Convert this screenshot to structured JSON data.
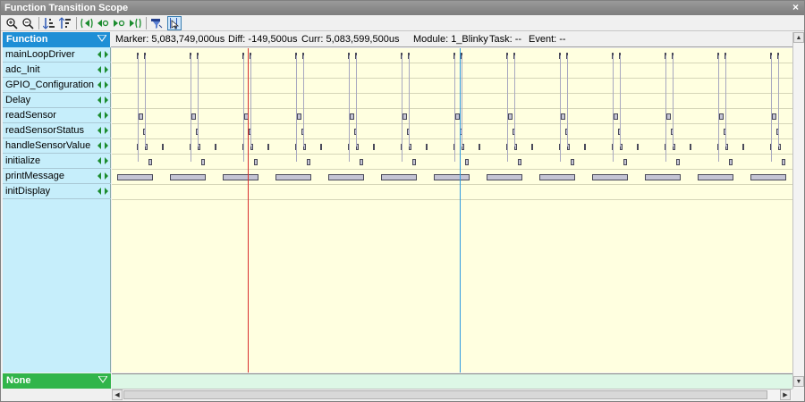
{
  "window": {
    "title": "Function Transition Scope",
    "close_glyph": "×"
  },
  "toolbar": {
    "buttons": [
      {
        "name": "zoom-in-icon"
      },
      {
        "name": "zoom-out-icon"
      },
      {
        "name": "sort-ascending-icon"
      },
      {
        "name": "sort-descending-icon"
      },
      {
        "name": "jump-first-icon"
      },
      {
        "name": "jump-previous-icon"
      },
      {
        "name": "jump-next-icon"
      },
      {
        "name": "jump-last-icon"
      },
      {
        "name": "filter-icon"
      },
      {
        "name": "cursor-mode-icon"
      }
    ]
  },
  "function_header": {
    "label": "Function"
  },
  "functions": [
    {
      "name": "mainLoopDriver"
    },
    {
      "name": "adc_Init"
    },
    {
      "name": "GPIO_Configuration"
    },
    {
      "name": "Delay"
    },
    {
      "name": "readSensor"
    },
    {
      "name": "readSensorStatus"
    },
    {
      "name": "handleSensorValue"
    },
    {
      "name": "initialize"
    },
    {
      "name": "printMessage"
    },
    {
      "name": "initDisplay"
    }
  ],
  "none_bar": {
    "label": "None"
  },
  "info": {
    "marker": "Marker: 5,083,749,000us",
    "diff": "Diff: -149,500us",
    "curr": "Curr: 5,083,599,500us",
    "module": "Module: 1_Blinky",
    "task": "Task: --",
    "event": "Event: --"
  },
  "colors": {
    "plot_bg": "#ffffe0",
    "marker_line": "#d93030",
    "cursor_line": "#2f9be0",
    "function_header": "#1e8fd6",
    "function_list": "#c6eefb",
    "none_bar": "#31b54a"
  }
}
